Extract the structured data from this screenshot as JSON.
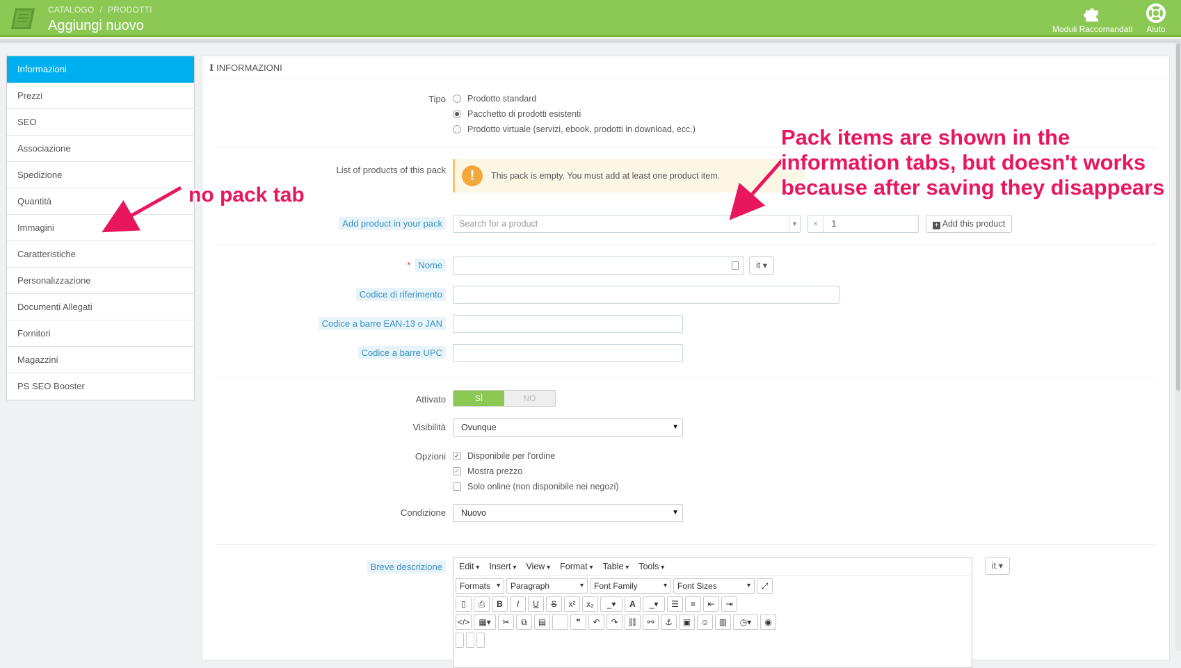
{
  "header": {
    "breadcrumb": [
      "CATALOGO",
      "PRODOTTI"
    ],
    "title": "Aggiungi nuovo",
    "tools": [
      "Moduli Raccomandati",
      "Aiuto"
    ]
  },
  "sidebar": {
    "items": [
      "Informazioni",
      "Prezzi",
      "SEO",
      "Associazione",
      "Spedizione",
      "Quantità",
      "Immagini",
      "Caratteristiche",
      "Personalizzazione",
      "Documenti Allegati",
      "Fornitori",
      "Magazzini",
      "PS SEO Booster"
    ],
    "active": "Informazioni"
  },
  "panel": {
    "heading": "INFORMAZIONI",
    "tipo": {
      "label": "Tipo",
      "options": [
        "Prodotto standard",
        "Pacchetto di prodotti esistenti",
        "Prodotto virtuale (servizi, ebook, prodotti in download, ecc.)"
      ],
      "selected": "Pacchetto di prodotti esistenti"
    },
    "pack": {
      "list_label": "List of products of this pack",
      "alert": "This pack is empty. You must add at least one product item.",
      "add_label": "Add product in your pack",
      "search_placeholder": "Search for a product",
      "quantity": "1",
      "clear_glyph": "×",
      "add_button": "Add this product"
    },
    "nome": {
      "label": "Nome",
      "lang": "it"
    },
    "reference": {
      "label": "Codice di riferimento"
    },
    "ean": {
      "label": "Codice a barre EAN-13 o JAN"
    },
    "upc": {
      "label": "Codice a barre UPC"
    },
    "attivato": {
      "label": "Attivato",
      "on": "SÌ",
      "off": "NO"
    },
    "visibilita": {
      "label": "Visibilità",
      "value": "Ovunque"
    },
    "opzioni": {
      "label": "Opzioni",
      "items": [
        {
          "text": "Disponibile per l'ordine",
          "checked": true
        },
        {
          "text": "Mostra prezzo",
          "checked": true
        },
        {
          "text": "Solo online (non disponibile nei negozi)",
          "checked": false
        }
      ]
    },
    "condizione": {
      "label": "Condizione",
      "value": "Nuovo"
    },
    "breve": {
      "label": "Breve descrizione",
      "lang": "it",
      "menus": [
        "Edit",
        "Insert",
        "View",
        "Format",
        "Table",
        "Tools"
      ],
      "formats": "Formats",
      "block": "Paragraph",
      "font_family": "Font Family",
      "font_sizes": "Font Sizes"
    }
  },
  "annotations": {
    "left": "no pack tab",
    "right": [
      "Pack items are shown in the",
      "information tabs, but doesn't works",
      "because after saving they disappears"
    ]
  },
  "colors": {
    "header": "#8bc954",
    "active_tab": "#00aff0",
    "annotation": "#e8175d",
    "warning": "#f3a83c"
  }
}
